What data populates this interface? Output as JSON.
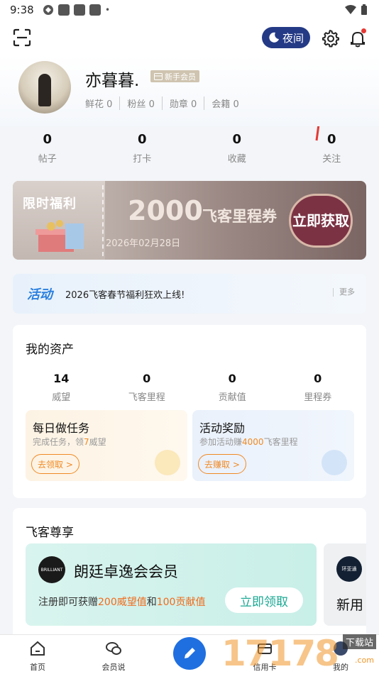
{
  "status": {
    "time": "9:38"
  },
  "topbar": {
    "night_label": "夜间"
  },
  "profile": {
    "name": "亦暮暮.",
    "badge": "新手会员",
    "stats": [
      {
        "label": "鲜花",
        "value": "0"
      },
      {
        "label": "粉丝",
        "value": "0"
      },
      {
        "label": "勋章",
        "value": "0"
      },
      {
        "label": "会籍",
        "value": "0"
      }
    ]
  },
  "counts": [
    {
      "value": "0",
      "label": "帖子"
    },
    {
      "value": "0",
      "label": "打卡"
    },
    {
      "value": "0",
      "label": "收藏"
    },
    {
      "value": "0",
      "label": "关注"
    }
  ],
  "banner": {
    "tag": "限时福利",
    "amount": "2000",
    "unit": "飞客里程券",
    "date": "2026年02月28日",
    "cta": "立即获取"
  },
  "activity": {
    "title": "活动",
    "text": "2026飞客春节福利狂欢上线!",
    "more": "更多"
  },
  "assets": {
    "title": "我的资产",
    "items": [
      {
        "value": "14",
        "label": "威望"
      },
      {
        "value": "0",
        "label": "飞客里程"
      },
      {
        "value": "0",
        "label": "贡献值"
      },
      {
        "value": "0",
        "label": "里程券"
      }
    ],
    "daily_task": {
      "title": "每日做任务",
      "sub_prefix": "完成任务，领",
      "sub_highlight": "7",
      "sub_suffix": "威望",
      "button": "去领取 >"
    },
    "activity_reward": {
      "title": "活动奖励",
      "sub_prefix": "参加活动赚",
      "sub_highlight": "4000",
      "sub_suffix": "飞客里程",
      "button": "去赚取 >"
    }
  },
  "privilege": {
    "title": "飞客尊享",
    "card1": {
      "logo_text": "BRILLIANT",
      "title": "朗廷卓逸会会员",
      "sub_a": "注册即可获赠",
      "sub_b": "200威望值",
      "sub_c": "和",
      "sub_d": "100贡献值",
      "button": "立即领取"
    },
    "card2": {
      "logo_text": "环亚通",
      "title": "新用"
    }
  },
  "tabbar": {
    "items": [
      {
        "label": "首页"
      },
      {
        "label": "会员说"
      },
      {
        "label": "信用卡"
      },
      {
        "label": "我的"
      }
    ]
  },
  "watermark": {
    "big": "17178",
    "small": "下载站",
    "url": ".com"
  },
  "colors": {
    "accent": "#1f6fe0",
    "night": "#243a86",
    "orange": "#f08a24",
    "teal": "#1aa893"
  }
}
